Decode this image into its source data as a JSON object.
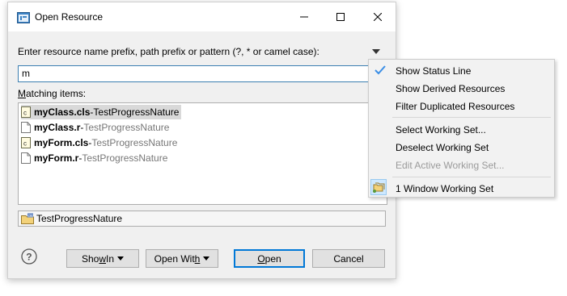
{
  "window": {
    "title": "Open Resource",
    "minimize_glyph": "—",
    "maximize_glyph": "☐",
    "close_glyph": "✕"
  },
  "prompt": {
    "label": "Enter resource name prefix, path prefix or pattern (?, * or camel case):"
  },
  "search": {
    "value": "m"
  },
  "matching": {
    "label_prefix": "M",
    "label_rest": "atching items:"
  },
  "results": [
    {
      "name": "myClass.cls",
      "separator": " - ",
      "nature": "TestProgressNature",
      "icon": "cls-file-icon",
      "selected": true
    },
    {
      "name": "myClass.r",
      "separator": " - ",
      "nature": "TestProgressNature",
      "icon": "file-icon",
      "selected": false
    },
    {
      "name": "myForm.cls",
      "separator": " - ",
      "nature": "TestProgressNature",
      "icon": "cls-file-icon",
      "selected": false
    },
    {
      "name": "myForm.r",
      "separator": " - ",
      "nature": "TestProgressNature",
      "icon": "file-icon",
      "selected": false
    }
  ],
  "status": {
    "text": "TestProgressNature",
    "icon": "project-folder-icon"
  },
  "buttons": {
    "show_in_a": "Sho",
    "show_in_u": "w",
    "show_in_b": " In",
    "open_with_a": "Open Wit",
    "open_with_u": "h",
    "open_with_b": "",
    "open_u": "O",
    "open_rest": "pen",
    "cancel": "Cancel"
  },
  "menu": {
    "items": [
      {
        "label": "Show Status Line",
        "checked": true,
        "enabled": true
      },
      {
        "label": "Show Derived Resources",
        "checked": false,
        "enabled": true
      },
      {
        "label": "Filter Duplicated Resources",
        "checked": false,
        "enabled": true
      },
      {
        "label": "Select Working Set...",
        "checked": false,
        "enabled": true
      },
      {
        "label": "Deselect Working Set",
        "checked": false,
        "enabled": true
      },
      {
        "label": "Edit Active Working Set...",
        "checked": false,
        "enabled": false
      },
      {
        "label": "1 Window Working Set",
        "checked": false,
        "enabled": true
      }
    ]
  },
  "colors": {
    "accent": "#0078d7",
    "selection": "#d9d9d9",
    "check": "#3a8ee6"
  }
}
